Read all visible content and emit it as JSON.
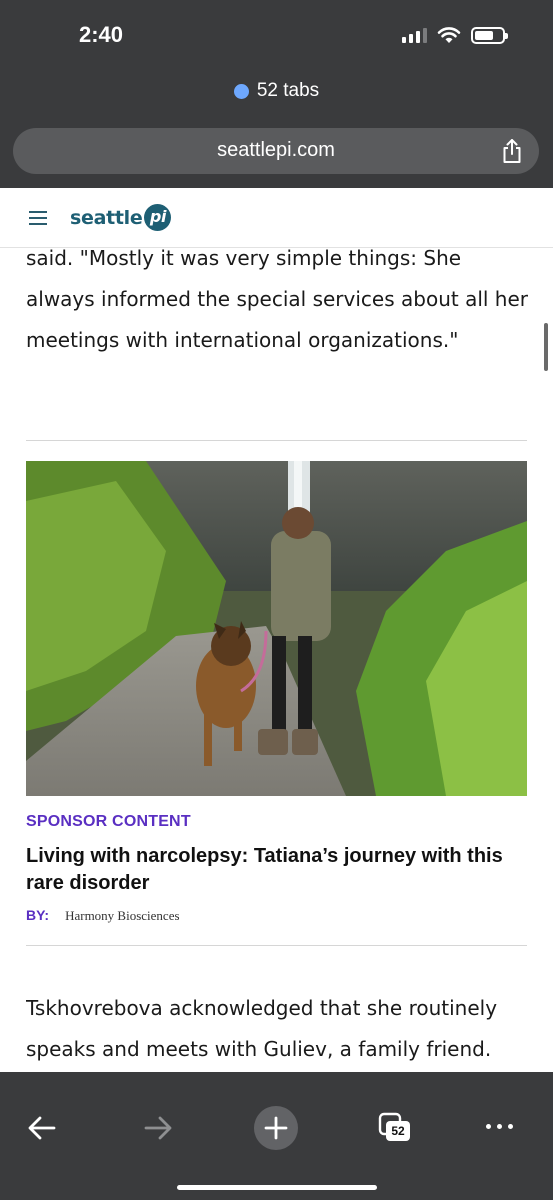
{
  "status_bar": {
    "time": "2:40"
  },
  "browser": {
    "tabs_label": "52 tabs",
    "url": "seattlepi.com",
    "tab_count": "52"
  },
  "site": {
    "logo_text": "seattle",
    "logo_badge": "pi"
  },
  "article": {
    "paragraph_top": "said. \"Mostly it was very simple things: She always informed the special services about all her meetings with international organizations.\"",
    "paragraph_bottom": "Tskhovrebova acknowledged that she routinely speaks and meets with Guliev, a family friend. During a television interview with"
  },
  "sponsor": {
    "label": "SPONSOR CONTENT",
    "title": "Living with narcolepsy: Tatiana’s journey with this rare disorder",
    "by_label": "BY:",
    "by_name": "Harmony Biosciences"
  }
}
